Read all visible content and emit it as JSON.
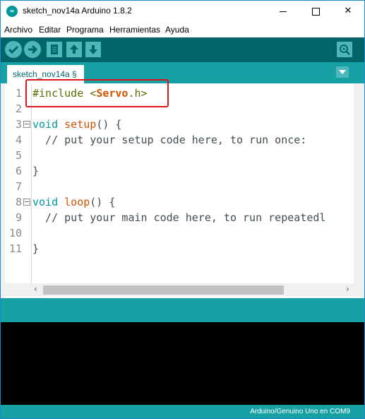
{
  "window": {
    "title": "sketch_nov14a Arduino 1.8.2",
    "minimize": "—",
    "maximize": "☐",
    "close": "✕",
    "icon": "arduino-logo-icon"
  },
  "menu": {
    "items": [
      "Archivo",
      "Editar",
      "Programa",
      "Herramientas",
      "Ayuda"
    ]
  },
  "toolbar": {
    "buttons": [
      "verify-icon",
      "upload-icon",
      "new-icon",
      "open-icon",
      "save-icon"
    ],
    "serial_monitor": "serial-monitor-icon"
  },
  "tabs": {
    "active": "sketch_nov14a §"
  },
  "editor": {
    "line_numbers": [
      "1",
      "2",
      "3",
      "4",
      "5",
      "6",
      "7",
      "8",
      "9",
      "10",
      "11"
    ],
    "lines": [
      {
        "segments": [
          {
            "t": "#include <",
            "c": "pp"
          },
          {
            "t": "Servo",
            "c": "bold"
          },
          {
            "t": ".h>",
            "c": "pp"
          }
        ]
      },
      {
        "segments": []
      },
      {
        "segments": [
          {
            "t": "void",
            "c": "kw"
          },
          {
            "t": " ",
            "c": "cm"
          },
          {
            "t": "setup",
            "c": "fn"
          },
          {
            "t": "() {",
            "c": "cm"
          }
        ]
      },
      {
        "segments": [
          {
            "t": "  // put your setup code here, to run once:",
            "c": "cm"
          }
        ]
      },
      {
        "segments": []
      },
      {
        "segments": [
          {
            "t": "}",
            "c": "cm"
          }
        ]
      },
      {
        "segments": []
      },
      {
        "segments": [
          {
            "t": "void",
            "c": "kw"
          },
          {
            "t": " ",
            "c": "cm"
          },
          {
            "t": "loop",
            "c": "fn"
          },
          {
            "t": "() {",
            "c": "cm"
          }
        ]
      },
      {
        "segments": [
          {
            "t": "  // put your main code here, to run repeatedl",
            "c": "cm"
          }
        ]
      },
      {
        "segments": []
      },
      {
        "segments": [
          {
            "t": "}",
            "c": "cm"
          }
        ]
      }
    ],
    "fold_lines": [
      2,
      7
    ]
  },
  "status": {
    "board": "Arduino/Genuino Uno en COM9"
  },
  "colors": {
    "teal_dark": "#006468",
    "teal": "#17a1a5",
    "highlight": "#e0141e"
  }
}
